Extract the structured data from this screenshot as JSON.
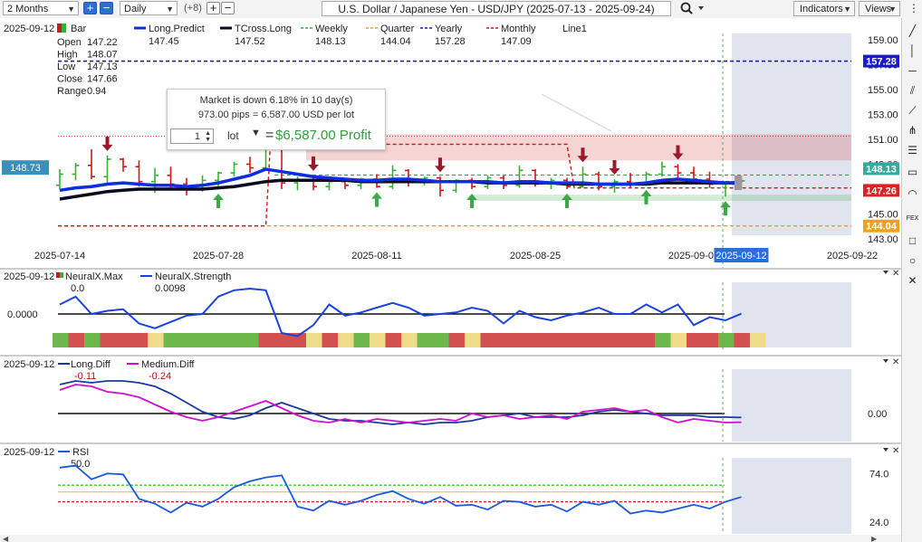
{
  "toolbar": {
    "range": "2 Months",
    "interval": "Daily",
    "offset": "(+8)",
    "title": "U.S. Dollar / Japanese Yen - USD/JPY (2025-07-13 - 2025-09-24)",
    "indicators": "Indicators",
    "views": "Views"
  },
  "colors": {
    "candle_up": "#33b333",
    "candle_down": "#d01818",
    "long_predict": "#0a2ee0",
    "tcross_long": "#0a0a20",
    "weekly": "#2ab04a",
    "quarter": "#f0a020",
    "yearly": "#1a1acc",
    "monthly": "#dd1111",
    "arrow_up": "#3da84a",
    "arrow_down": "#9a1a2a",
    "neural_strength": "#1a44dd",
    "long_diff": "#1a3a9a",
    "medium_diff": "#d010d0",
    "rsi": "#1a5ae0"
  },
  "chart_data": [
    {
      "type": "candlestick",
      "panel": "price",
      "date_label": "2025-09-12",
      "ohlc_label": "Bar",
      "readout": [
        {
          "label": "Open",
          "value": "147.22"
        },
        {
          "label": "High",
          "value": "148.07"
        },
        {
          "label": "Low",
          "value": "147.13"
        },
        {
          "label": "Close",
          "value": "147.66"
        },
        {
          "label": "Range",
          "value": "0.94"
        }
      ],
      "legend": [
        {
          "name": "Long.Predict",
          "value": "147.45",
          "style": "solid",
          "color": "#0a2ee0"
        },
        {
          "name": "TCross.Long",
          "value": "147.52",
          "style": "solid",
          "color": "#0a0a20"
        },
        {
          "name": "Weekly",
          "value": "148.13",
          "style": "dashed",
          "color": "#2ab04a"
        },
        {
          "name": "Quarter",
          "value": "144.04",
          "style": "dashed",
          "color": "#f0a020"
        },
        {
          "name": "Yearly",
          "value": "157.28",
          "style": "dashed",
          "color": "#1a1acc"
        },
        {
          "name": "Monthly",
          "value": "147.09",
          "style": "dashed",
          "color": "#dd1111"
        },
        {
          "name": "Line1",
          "value": "",
          "style": "none",
          "color": "#999999"
        }
      ],
      "x_tick_labels": [
        "2025-07-14",
        "2025-07-28",
        "2025-08-11",
        "2025-08-25",
        "2025-09-08",
        "2025-09-12",
        "2025-09-22"
      ],
      "x_tick_index": [
        0,
        10,
        20,
        30,
        40,
        43,
        50
      ],
      "highlighted_x_label": "2025-09-12",
      "y_ticks": [
        143.0,
        145.0,
        147.0,
        149.0,
        151.0,
        153.0,
        155.0,
        157.0,
        159.0
      ],
      "ylim": [
        143.0,
        159.5
      ],
      "price_tags": [
        {
          "value": 157.28,
          "label": "157.28",
          "color": "#1a1acc"
        },
        {
          "value": 148.13,
          "label": "148.13",
          "color": "#3aa89a"
        },
        {
          "value": 147.26,
          "label": "147.26",
          "color": "#dd2222"
        },
        {
          "value": 144.04,
          "label": "144.04",
          "color": "#f0a020"
        }
      ],
      "left_tag": {
        "value": 148.73,
        "label": "148.73"
      },
      "levels": {
        "yearly": 157.28,
        "weekly": 148.13,
        "monthly_after": 147.09,
        "monthly_before": 144.04,
        "monthly_prev": 150.6,
        "quarter": 144.04,
        "resistance_zone": [
          149.3,
          151.4
        ],
        "support_zone": [
          146.05,
          146.55
        ]
      },
      "candles": [
        [
          147.3,
          148.6,
          147.0,
          148.2
        ],
        [
          148.2,
          149.1,
          147.7,
          148.9
        ],
        [
          148.9,
          150.2,
          147.8,
          148.0
        ],
        [
          148.0,
          149.7,
          147.5,
          149.4
        ],
        [
          149.4,
          149.5,
          148.4,
          148.8
        ],
        [
          148.8,
          149.3,
          147.2,
          147.6
        ],
        [
          147.6,
          148.7,
          146.7,
          148.1
        ],
        [
          148.1,
          148.8,
          146.9,
          147.4
        ],
        [
          147.4,
          147.9,
          146.5,
          147.0
        ],
        [
          147.0,
          148.1,
          146.8,
          147.7
        ],
        [
          147.7,
          148.4,
          147.0,
          148.3
        ],
        [
          148.3,
          149.2,
          148.0,
          149.0
        ],
        [
          149.0,
          149.6,
          148.3,
          148.7
        ],
        [
          148.7,
          150.3,
          148.5,
          150.2
        ],
        [
          150.2,
          150.8,
          147.0,
          147.5
        ],
        [
          147.5,
          148.0,
          146.9,
          147.7
        ],
        [
          147.7,
          148.1,
          146.9,
          147.2
        ],
        [
          147.2,
          147.8,
          146.9,
          147.6
        ],
        [
          147.6,
          147.9,
          147.0,
          147.3
        ],
        [
          147.3,
          147.9,
          147.0,
          147.8
        ],
        [
          147.8,
          148.2,
          147.1,
          147.2
        ],
        [
          147.2,
          148.9,
          147.0,
          148.5
        ],
        [
          148.5,
          148.6,
          147.2,
          147.6
        ],
        [
          147.6,
          148.0,
          147.3,
          147.9
        ],
        [
          147.9,
          148.0,
          146.4,
          146.9
        ],
        [
          146.9,
          147.8,
          146.7,
          147.7
        ],
        [
          147.7,
          147.9,
          147.0,
          147.2
        ],
        [
          147.2,
          148.1,
          147.0,
          147.9
        ],
        [
          147.9,
          148.1,
          147.0,
          147.3
        ],
        [
          147.3,
          148.9,
          147.1,
          148.5
        ],
        [
          148.5,
          148.6,
          147.2,
          147.4
        ],
        [
          147.4,
          147.9,
          147.0,
          147.7
        ],
        [
          147.7,
          147.9,
          147.0,
          147.2
        ],
        [
          147.2,
          148.8,
          147.1,
          148.2
        ],
        [
          148.2,
          148.4,
          146.9,
          147.2
        ],
        [
          147.2,
          147.8,
          146.7,
          147.6
        ],
        [
          147.6,
          148.3,
          147.1,
          147.4
        ],
        [
          147.4,
          148.4,
          147.3,
          148.2
        ],
        [
          148.2,
          149.2,
          148.0,
          148.8
        ],
        [
          148.8,
          149.0,
          147.9,
          148.3
        ],
        [
          148.3,
          148.8,
          147.6,
          147.8
        ],
        [
          147.8,
          148.4,
          147.1,
          147.4
        ],
        [
          147.4,
          147.6,
          146.4,
          147.6
        ],
        [
          147.2,
          148.07,
          147.13,
          147.66
        ]
      ],
      "long_predict": [
        146.9,
        147.1,
        147.2,
        147.4,
        147.5,
        147.4,
        147.3,
        147.3,
        147.2,
        147.3,
        147.5,
        147.8,
        148.1,
        148.6,
        148.4,
        148.2,
        148.0,
        147.9,
        147.8,
        147.7,
        147.7,
        147.8,
        147.8,
        147.7,
        147.6,
        147.6,
        147.6,
        147.6,
        147.5,
        147.6,
        147.6,
        147.5,
        147.5,
        147.5,
        147.4,
        147.4,
        147.4,
        147.5,
        147.7,
        147.8,
        147.7,
        147.6,
        147.5,
        147.45
      ],
      "tcross_long": [
        146.2,
        146.4,
        146.6,
        146.8,
        146.9,
        147.0,
        147.0,
        147.0,
        147.0,
        147.0,
        147.1,
        147.2,
        147.4,
        147.6,
        147.7,
        147.7,
        147.7,
        147.7,
        147.7,
        147.6,
        147.6,
        147.6,
        147.6,
        147.6,
        147.6,
        147.6,
        147.6,
        147.5,
        147.5,
        147.5,
        147.5,
        147.5,
        147.4,
        147.4,
        147.4,
        147.4,
        147.4,
        147.4,
        147.5,
        147.5,
        147.5,
        147.5,
        147.5,
        147.52
      ],
      "arrows_up": [
        10,
        20,
        26,
        32,
        37,
        42
      ],
      "arrows_down": [
        3,
        16,
        24,
        33,
        35,
        39
      ]
    },
    {
      "type": "line+bar",
      "panel": "neuralx",
      "date_label": "2025-09-12",
      "series": [
        {
          "name": "NeuralX.Max",
          "value": "0.0"
        },
        {
          "name": "NeuralX.Strength",
          "value": "0.0098"
        }
      ],
      "y_tick_labels": [
        "0.0000"
      ],
      "ylim": [
        -1,
        1
      ],
      "zero": 0,
      "values": [
        0.3,
        0.55,
        0.0,
        0.1,
        0.15,
        -0.3,
        -0.45,
        -0.25,
        -0.05,
        0.0,
        0.55,
        0.75,
        0.8,
        0.75,
        -0.6,
        -0.7,
        -0.35,
        0.3,
        -0.05,
        0.05,
        0.2,
        0.35,
        0.2,
        -0.05,
        0.0,
        0.05,
        0.2,
        0.1,
        -0.3,
        0.1,
        -0.1,
        -0.2,
        -0.05,
        0.05,
        0.2,
        0.0,
        0.0,
        0.3,
        0.05,
        0.3,
        -0.35,
        -0.1,
        -0.2,
        0.0098
      ],
      "strip": [
        "g",
        "r",
        "g",
        "r",
        "r",
        "r",
        "y",
        "g",
        "g",
        "g",
        "g",
        "g",
        "g",
        "r",
        "r",
        "r",
        "y",
        "r",
        "y",
        "g",
        "y",
        "r",
        "y",
        "g",
        "g",
        "r",
        "y",
        "r",
        "r",
        "r",
        "r",
        "r",
        "r",
        "r",
        "r",
        "r",
        "r",
        "r",
        "g",
        "y",
        "r",
        "r",
        "g",
        "r",
        "y"
      ]
    },
    {
      "type": "line",
      "panel": "diff",
      "date_label": "2025-09-12",
      "series": [
        {
          "name": "Long.Diff",
          "value": "-0.11"
        },
        {
          "name": "Medium.Diff",
          "value": "-0.24"
        }
      ],
      "y_tick_labels": [
        "0.00"
      ],
      "ylim": [
        -1,
        1
      ],
      "zero": 0,
      "long_diff": [
        0.8,
        0.9,
        0.85,
        0.9,
        0.9,
        0.85,
        0.75,
        0.55,
        0.3,
        0.05,
        -0.1,
        -0.15,
        -0.05,
        0.15,
        0.3,
        0.15,
        0.0,
        -0.15,
        -0.2,
        -0.2,
        -0.25,
        -0.3,
        -0.25,
        -0.3,
        -0.25,
        -0.25,
        -0.2,
        -0.1,
        -0.05,
        0.0,
        -0.1,
        -0.1,
        -0.1,
        -0.05,
        0.05,
        0.1,
        0.05,
        0.0,
        -0.05,
        -0.05,
        -0.05,
        -0.1,
        -0.1,
        -0.11
      ],
      "medium_diff": [
        0.65,
        0.8,
        0.75,
        0.6,
        0.55,
        0.45,
        0.25,
        0.05,
        -0.1,
        -0.2,
        -0.1,
        0.05,
        0.2,
        0.35,
        0.15,
        -0.05,
        -0.2,
        -0.25,
        -0.15,
        -0.25,
        -0.15,
        -0.2,
        -0.25,
        -0.2,
        -0.15,
        -0.2,
        0.0,
        -0.1,
        -0.05,
        -0.15,
        -0.1,
        -0.05,
        -0.15,
        0.05,
        0.1,
        0.15,
        0.05,
        0.1,
        -0.1,
        -0.25,
        -0.15,
        -0.2,
        -0.25,
        -0.24
      ]
    },
    {
      "type": "line",
      "panel": "rsi",
      "date_label": "2025-09-12",
      "series": [
        {
          "name": "RSI",
          "value": "50.0"
        }
      ],
      "y_tick_labels": [
        "74.0",
        "24.0"
      ],
      "ylim": [
        14,
        90
      ],
      "bands": {
        "upper": 62,
        "middle": 55,
        "lower": 45
      },
      "values": [
        80,
        82,
        68,
        74,
        73,
        48,
        43,
        34,
        44,
        40,
        48,
        60,
        66,
        70,
        72,
        40,
        36,
        46,
        42,
        46,
        52,
        56,
        48,
        43,
        50,
        41,
        42,
        37,
        46,
        45,
        40,
        42,
        35,
        45,
        42,
        46,
        33,
        36,
        34,
        38,
        42,
        38,
        45,
        50
      ]
    }
  ],
  "tooltip": {
    "line1": "Market is down 6.18% in 10 day(s)",
    "line2": "973.00 pips = 6,587.00 USD per lot",
    "qty": "1",
    "unit": "lot",
    "equals": "=",
    "profit": "$6,587.00 Profit"
  }
}
